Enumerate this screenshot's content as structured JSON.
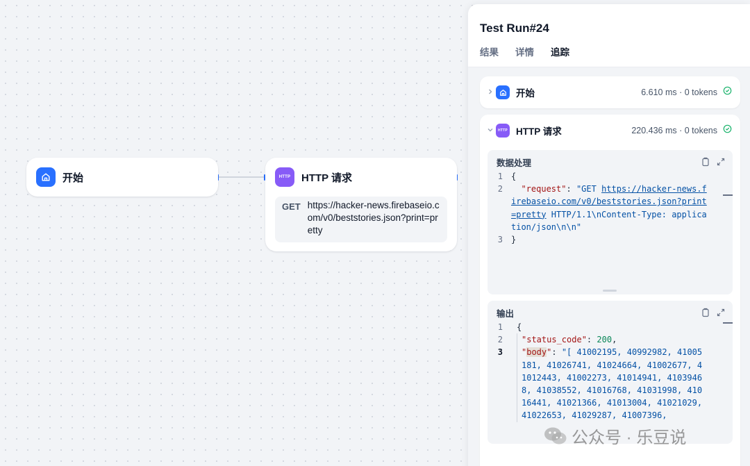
{
  "canvas": {
    "start_node": {
      "title": "开始",
      "icon": "home-icon"
    },
    "http_node": {
      "title": "HTTP 请求",
      "icon_text": "HTTP",
      "method": "GET",
      "url": "https://hacker-news.firebaseio.com/v0/beststories.json?print=pretty"
    }
  },
  "panel": {
    "title": "Test Run#24",
    "tabs": [
      {
        "label": "结果"
      },
      {
        "label": "详情"
      },
      {
        "label": "追踪",
        "active": true
      }
    ],
    "traces": [
      {
        "label": "开始",
        "meta": "6.610 ms · 0 tokens",
        "status": "success",
        "expanded": false
      },
      {
        "label": "HTTP 请求",
        "meta": "220.436 ms · 0 tokens",
        "status": "success",
        "expanded": true,
        "icon_text": "HTTP"
      }
    ],
    "input_block": {
      "title": "数据处理",
      "lines": [
        "{",
        "  \"request\": \"GET https://hacker-news.firebaseio.com/v0/beststories.json?print=pretty HTTP/1.1\\nContent-Type: application/json\\n\\n\"",
        "}"
      ],
      "key": "\"request\"",
      "value_prefix": "\"GET ",
      "value_link": "https://hacker-news.firebaseio.com/v0/beststories.json?print=pretty",
      "value_suffix": " HTTP/1.1\\nContent-Type: application/json\\n\\n\""
    },
    "output_block": {
      "title": "输出",
      "status_key": "\"status_code\"",
      "status_value": "200",
      "body_key": "body",
      "body_value": "\"[ 41002195, 40992982, 41005181, 41026741, 41024664, 41002677, 41012443, 41002273, 41014941, 41039468, 41038552, 41016768, 41031998, 41016441, 41021366, 41013004, 41021029, 41022653, 41029287, 41007396,"
    }
  },
  "watermark": {
    "text": "公众号 · 乐豆说"
  },
  "colors": {
    "accent": "#2970ff",
    "http_icon": "#875bf7",
    "success": "#17b26a"
  }
}
